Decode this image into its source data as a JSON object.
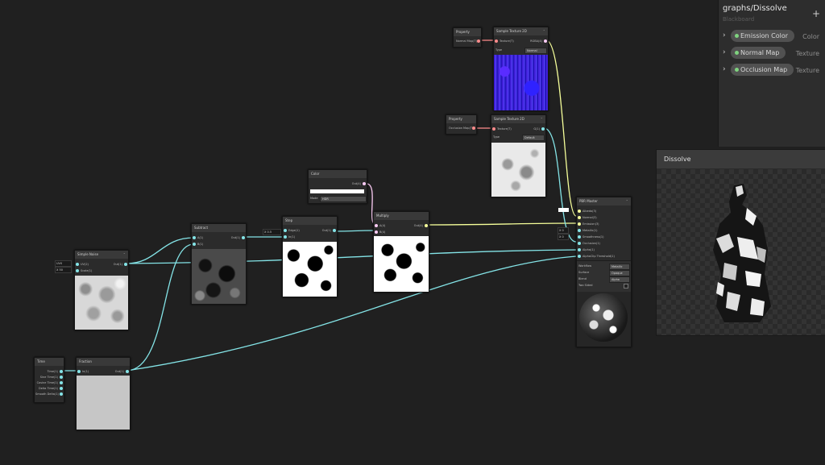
{
  "blackboard": {
    "title": "graphs/Dissolve",
    "subtitle": "Blackboard",
    "add_label": "+",
    "properties": [
      {
        "name": "Emission Color",
        "type": "Color"
      },
      {
        "name": "Normal Map",
        "type": "Texture"
      },
      {
        "name": "Occlusion Map",
        "type": "Texture"
      }
    ]
  },
  "main_preview": {
    "title": "Dissolve"
  },
  "nodes": {
    "prop_normal": {
      "title": "Property",
      "out": "Normal Map(T)"
    },
    "sample_normal": {
      "title": "Sample Texture 2D",
      "in": "Texture(T)",
      "out": "RGBA(4)",
      "type_label": "Type",
      "type_value": "Normal"
    },
    "prop_occ": {
      "title": "Property",
      "out": "Occlusion Map(T)"
    },
    "sample_occ": {
      "title": "Sample Texture 2D",
      "in": "Texture(T)",
      "out": "G(1)",
      "type_label": "Type",
      "type_value": "Default"
    },
    "color": {
      "title": "Color",
      "out": "Out(4)",
      "mode_label": "Mode",
      "mode_value": "HDR"
    },
    "step": {
      "title": "Step",
      "in1": "Edge(1)",
      "in2": "In(1)",
      "out": "Out(1)",
      "edge_value": "X 0.5"
    },
    "subtract": {
      "title": "Subtract",
      "in1": "A(1)",
      "in2": "B(1)",
      "out": "Out(1)"
    },
    "multiply": {
      "title": "Multiply",
      "in1": "A(4)",
      "in2": "B(4)",
      "out": "Out(4)"
    },
    "noise": {
      "title": "Simple Noise",
      "in1": "UV(2)",
      "in2": "Scale(1)",
      "out": "Out(1)",
      "uv_value": "UV0",
      "scale_value": "X 50"
    },
    "time": {
      "title": "Time",
      "outs": [
        "Time(1)",
        "Sine Time(1)",
        "Cosine Time(1)",
        "Delta Time(1)",
        "Smooth Delta(1)"
      ]
    },
    "fraction": {
      "title": "Fraction",
      "in": "In(1)",
      "out": "Out(1)"
    },
    "pbr": {
      "title": "PBR Master",
      "inputs": [
        "Albedo(3)",
        "Normal(3)",
        "Emission(3)",
        "Metallic(1)",
        "Smoothness(1)",
        "Occlusion(1)",
        "Alpha(1)",
        "AlphaClip Threshold(1)"
      ],
      "metallic_value": "X 0",
      "smooth_value": "X 0",
      "settings": [
        {
          "label": "Workflow",
          "value": "Metallic"
        },
        {
          "label": "Surface",
          "value": "Opaque"
        },
        {
          "label": "Blend",
          "value": "Alpha"
        },
        {
          "label": "Two Sided",
          "value": ""
        }
      ]
    }
  }
}
